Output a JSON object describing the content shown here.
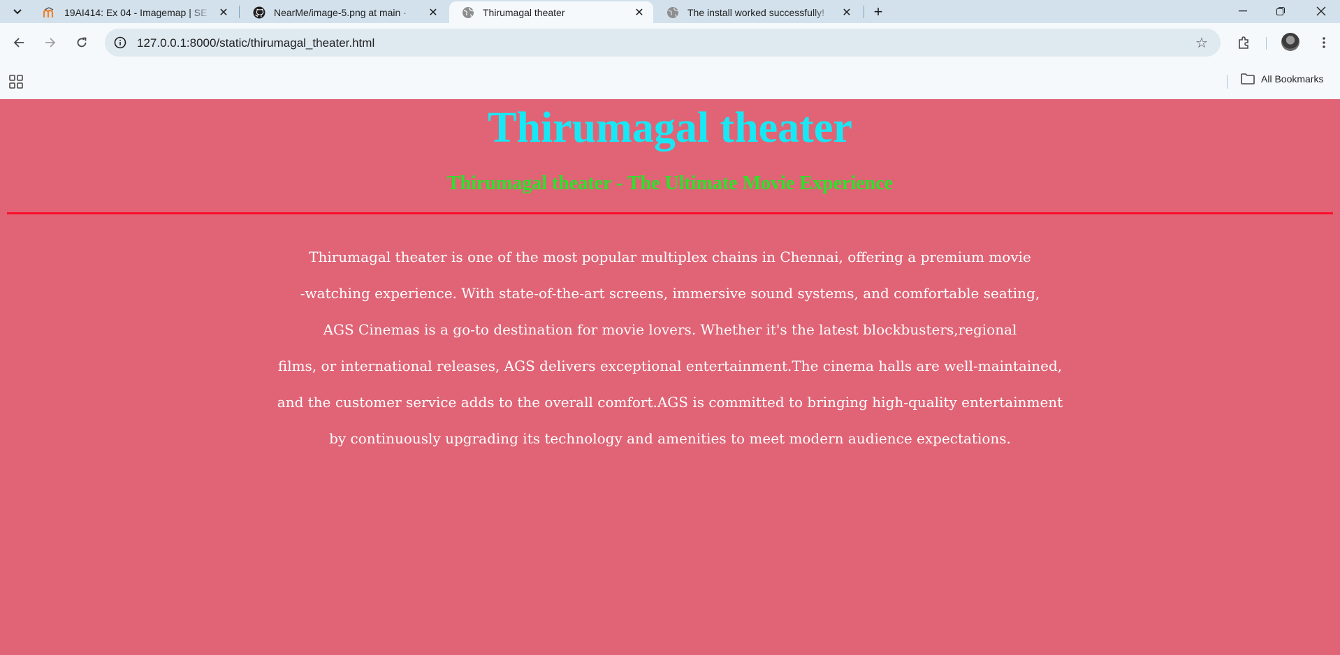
{
  "browser": {
    "tabs": [
      {
        "title": "19AI414: Ex 04 - Imagemap | SE",
        "favicon": "moodle-icon",
        "active": false
      },
      {
        "title": "NearMe/image-5.png at main ·",
        "favicon": "github-icon",
        "active": false
      },
      {
        "title": "Thirumagal theater",
        "favicon": "globe-icon",
        "active": true
      },
      {
        "title": "The install worked successfully!",
        "favicon": "globe-icon",
        "active": false
      }
    ],
    "new_tab_label": "+",
    "address_bar": {
      "url": "127.0.0.1:8000/static/thirumagal_theater.html"
    },
    "bookmarks": {
      "all_bookmarks_label": "All Bookmarks"
    }
  },
  "page": {
    "background_color": "#e06476",
    "title": "Thirumagal theater",
    "title_color": "#17e8f5",
    "subtitle": "Thirumagal theater - The Ultimate Movie Experience",
    "subtitle_color": "#2ee02b",
    "divider_color": "#ff0c2c",
    "paragraph_lines": [
      "Thirumagal theater is one of the most popular multiplex chains in Chennai, offering a premium movie",
      "-watching experience. With state-of-the-art screens, immersive sound systems, and comfortable seating,",
      "AGS Cinemas is a go-to destination for movie lovers. Whether it's the latest blockbusters,regional",
      "films, or international releases, AGS delivers exceptional entertainment.The cinema halls are well-maintained,",
      "and the customer service adds to the overall comfort.AGS is committed to bringing high-quality entertainment",
      "by continuously upgrading its technology and amenities to meet modern audience expectations."
    ]
  }
}
